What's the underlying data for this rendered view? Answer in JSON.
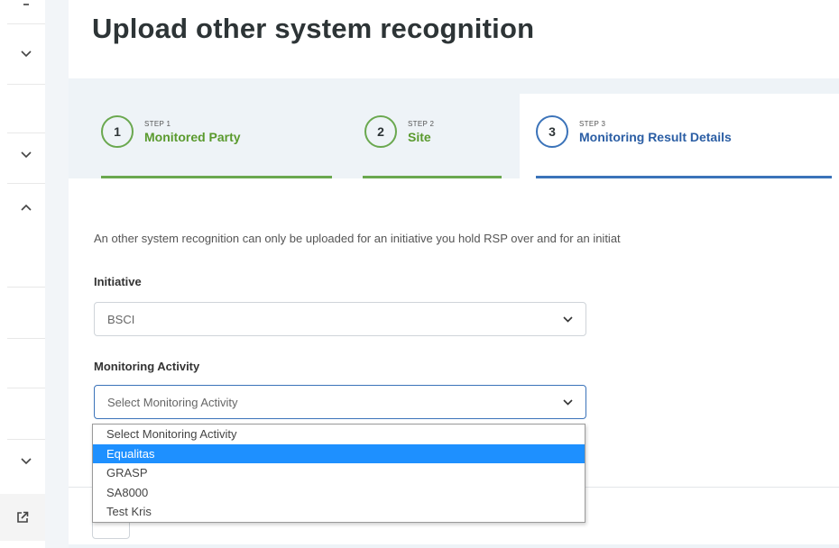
{
  "page": {
    "title": "Upload other system recognition"
  },
  "sidebar": {
    "icons": [
      "chevron-down-icon",
      "chevron-down-icon",
      "chevron-up-icon",
      "chevron-down-icon",
      "external-link-icon"
    ]
  },
  "stepper": {
    "steps": [
      {
        "step_label": "STEP 1",
        "name": "Monitored Party",
        "number": "1",
        "state": "completed"
      },
      {
        "step_label": "STEP 2",
        "name": "Site",
        "number": "2",
        "state": "completed"
      },
      {
        "step_label": "STEP 3",
        "name": "Monitoring Result Details",
        "number": "3",
        "state": "active"
      }
    ],
    "colors": {
      "completed": "#6aa84f",
      "active": "#3b73b9"
    }
  },
  "intro_text": "An other system recognition can only be uploaded for an initiative you hold RSP over and for an initiat",
  "form": {
    "initiative": {
      "label": "Initiative",
      "value": "BSCI"
    },
    "monitoring_activity": {
      "label": "Monitoring Activity",
      "value": "Select Monitoring Activity",
      "options": [
        "Select Monitoring Activity",
        "Equalitas",
        "GRASP",
        "SA8000",
        "Test Kris"
      ],
      "highlighted": "Equalitas"
    }
  },
  "colors": {
    "highlight": "#1e90ff",
    "background_panel": "#eef3f7"
  }
}
